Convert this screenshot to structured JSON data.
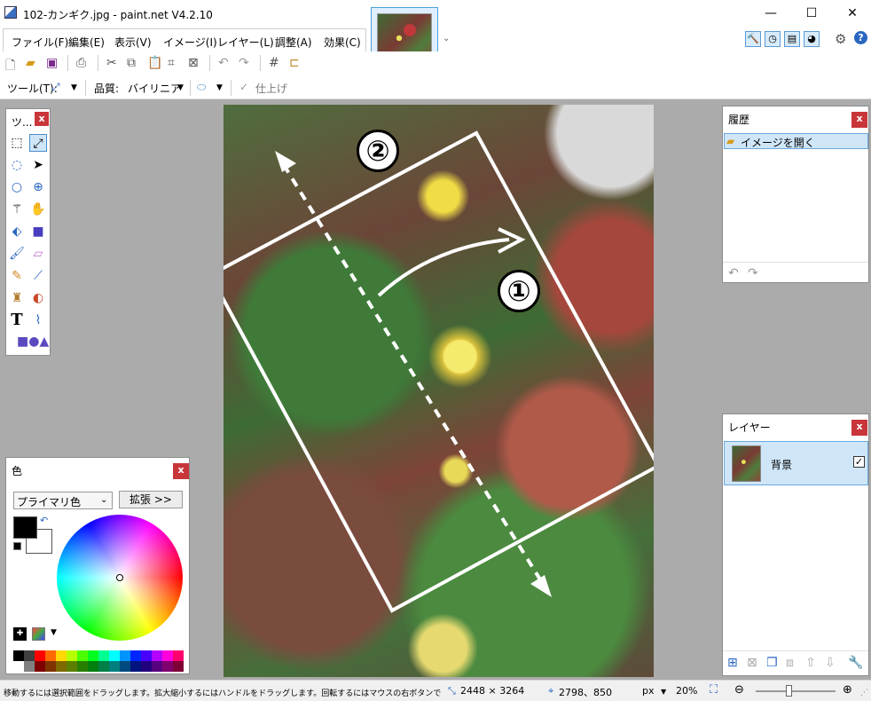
{
  "window": {
    "title": "102-カンギク.jpg - paint.net V4.2.10"
  },
  "menu": [
    {
      "label": "ファイル(F)"
    },
    {
      "label": "編集(E)"
    },
    {
      "label": "表示(V)"
    },
    {
      "label": "イメージ(I)"
    },
    {
      "label": "レイヤー(L)"
    },
    {
      "label": "調整(A)"
    },
    {
      "label": "効果(C)"
    }
  ],
  "toolbar2": {
    "tool_label": "ツール(T):",
    "quality_label": "品質:",
    "quality_value": "バイリニア",
    "finish_label": "仕上げ"
  },
  "tools_panel": {
    "title": "ツ..."
  },
  "history_panel": {
    "title": "履歴",
    "items": [
      {
        "label": "イメージを開く"
      }
    ]
  },
  "layers_panel": {
    "title": "レイヤー",
    "layers": [
      {
        "name": "背景",
        "visible": true
      }
    ]
  },
  "colors_panel": {
    "title": "色",
    "mode_select": "プライマリ色",
    "expand_button": "拡張 >>",
    "primary_color": "#000000",
    "secondary_color": "#ffffff",
    "palette_top": [
      "#000000",
      "#404040",
      "#ff0000",
      "#ff6a00",
      "#ffd800",
      "#b6ff00",
      "#4cff00",
      "#00ff21",
      "#00ff90",
      "#00ffff",
      "#0094ff",
      "#0026ff",
      "#4800ff",
      "#b200ff",
      "#ff00dc",
      "#ff006e"
    ],
    "palette_bottom": [
      "#ffffff",
      "#808080",
      "#7f0000",
      "#7f3300",
      "#7f6a00",
      "#5b7f00",
      "#267f00",
      "#007f0e",
      "#007f46",
      "#007f7f",
      "#004a7f",
      "#00137f",
      "#21007f",
      "#57007f",
      "#7f006e",
      "#7f0037"
    ]
  },
  "annotations": {
    "marker1": "①",
    "marker2": "②"
  },
  "status": {
    "hint": "移動するには選択範囲をドラッグします。拡大縮小するにはハンドルをドラッグします。回転するにはマウスの右ボタンでドラッグします。",
    "image_size": "2448 × 3264",
    "cursor_pos": "2798、850",
    "unit": "px",
    "zoom": "20%"
  }
}
